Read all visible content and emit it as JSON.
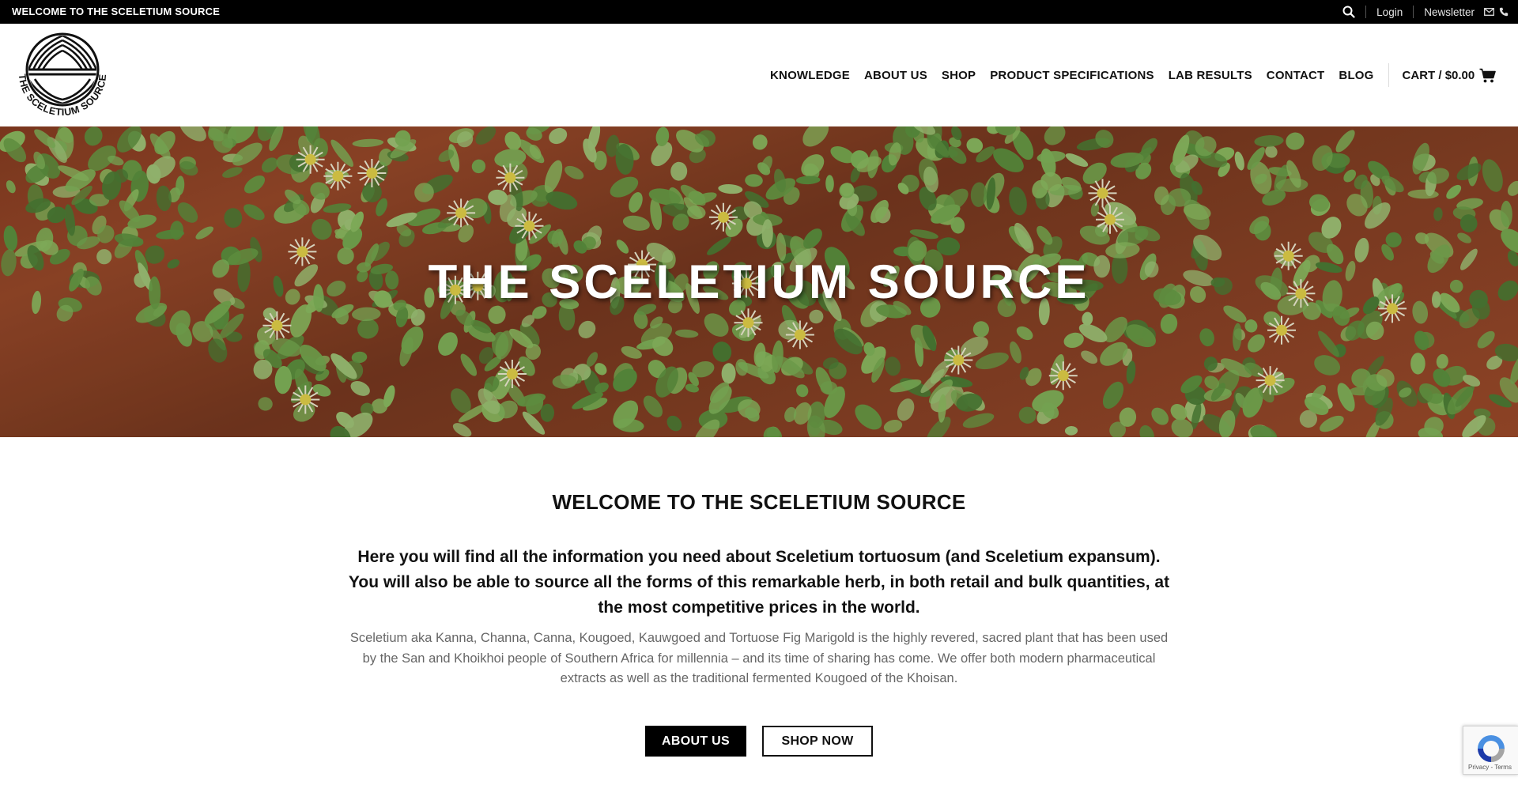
{
  "topbar": {
    "welcome": "WELCOME TO THE SCELETIUM SOURCE",
    "login": "Login",
    "newsletter": "Newsletter",
    "icons": [
      "search-icon",
      "envelope-icon",
      "phone-icon"
    ]
  },
  "header": {
    "logo_text": "THE SCELETIUM SOURCE",
    "nav": [
      "KNOWLEDGE",
      "ABOUT US",
      "SHOP",
      "PRODUCT SPECIFICATIONS",
      "LAB RESULTS",
      "CONTACT",
      "BLOG"
    ],
    "cart_label": "CART / $0.00"
  },
  "hero": {
    "title": "THE SCELETIUM SOURCE"
  },
  "content": {
    "heading": "WELCOME TO THE SCELETIUM SOURCE",
    "lead": "Here you will find all the information you need about Sceletium tortuosum (and Sceletium expansum). You will also be able to source all the forms of this remarkable herb, in both retail and bulk quantities, at the most competitive prices in the world.",
    "body": "Sceletium aka Kanna, Channa, Canna, Kougoed, Kauwgoed and Tortuose Fig Marigold is the highly revered, sacred plant that has been used by the San and Khoikhoi people of Southern Africa for millennia – and its time of sharing has come. We offer both modern pharmaceutical extracts as well as the traditional fermented Kougoed of the Khoisan.",
    "button_about": "ABOUT US",
    "button_shop": "SHOP NOW"
  },
  "recaptcha": {
    "privacy": "Privacy - Terms"
  },
  "colors": {
    "topbar": "#000000",
    "text": "#111111",
    "muted": "#666666",
    "soil": "#8c4326",
    "leaf": "#6fa24a"
  }
}
